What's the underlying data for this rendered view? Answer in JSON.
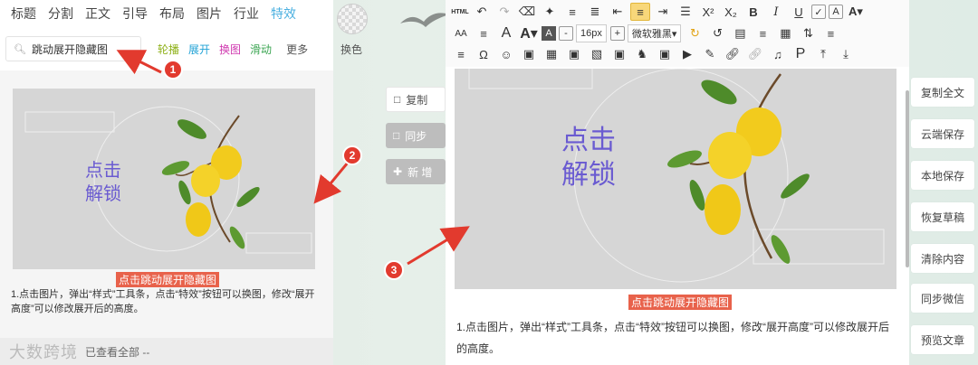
{
  "left_panel": {
    "tabs": [
      "标题",
      "分割",
      "正文",
      "引导",
      "布局",
      "图片",
      "行业",
      "特效"
    ],
    "active_tab": "特效",
    "search": {
      "value": "跳动展开隐藏图"
    },
    "subtabs": [
      {
        "label": "轮播",
        "color": "#8fb11a"
      },
      {
        "label": "展开",
        "color": "#23a3d6"
      },
      {
        "label": "换图",
        "color": "#d03ab0"
      },
      {
        "label": "滑动",
        "color": "#3ba552"
      },
      {
        "label": "更多",
        "color": "#555555"
      }
    ],
    "color_label": "换色",
    "preview": {
      "unlock_line1": "点击",
      "unlock_line2": "解锁"
    },
    "caption": "点击跳动展开隐藏图",
    "description": "1.点击图片，弹出“样式”工具条，点击“特效”按钮可以换图，修改“展开高度”可以修改展开后的高度。",
    "footer": {
      "brand": "大数跨境",
      "status": "已查看全部 --"
    }
  },
  "middle_actions": {
    "copy": "复制",
    "sync": "同步",
    "new": "新 增"
  },
  "editor": {
    "font_size": "16px",
    "font_family": "微软雅黑",
    "preview": {
      "unlock_line1": "点击",
      "unlock_line2": "解锁"
    },
    "caption": "点击跳动展开隐藏图",
    "description": "1.点击图片，弹出“样式”工具条，点击“特效”按钮可以换图，修改“展开高度”可以修改展开后的高度。"
  },
  "right_sidebar": [
    "复制全文",
    "云端保存",
    "本地保存",
    "恢复草稿",
    "清除内容",
    "同步微信",
    "预览文章"
  ],
  "annotations": [
    "1",
    "2",
    "3"
  ],
  "colors": {
    "accent": "#4bb0e0",
    "highlight": "#e8624b",
    "badge": "#e23a2e",
    "unlock": "#6a5bd1"
  },
  "icons": [
    "search-icon",
    "copy-icon",
    "sync-icon",
    "plus-icon",
    "undo-icon",
    "redo-icon"
  ]
}
